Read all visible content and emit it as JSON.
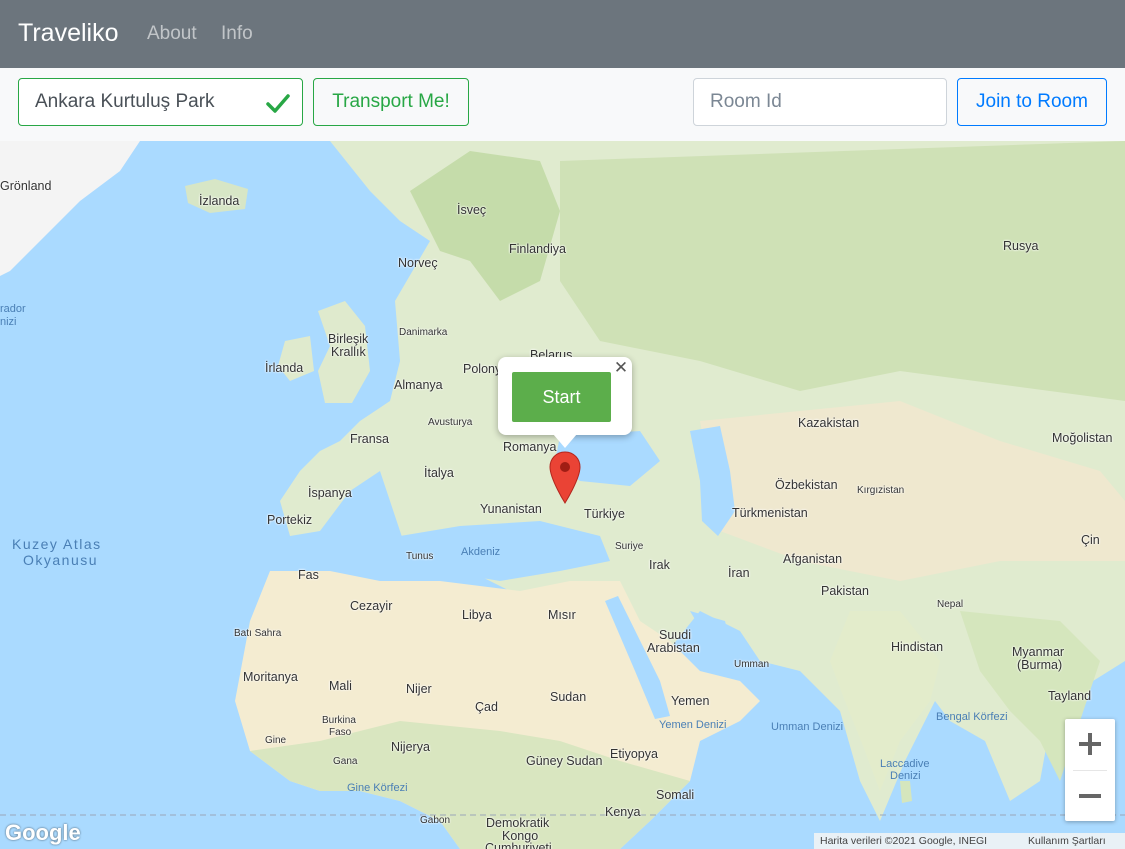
{
  "navbar": {
    "brand": "Traveliko",
    "links": [
      "About",
      "Info"
    ]
  },
  "toolbar": {
    "destination_value": "Ankara Kurtuluş Park",
    "transport_label": "Transport Me!",
    "room_placeholder": "Room Id",
    "join_label": "Join to Room"
  },
  "map": {
    "popup_button": "Start",
    "labels": {
      "gronland": "Grönland",
      "izlanda": "İzlanda",
      "isvec": "İsveç",
      "finlandiya": "Finlandiya",
      "norvec": "Norveç",
      "rusya": "Rusya",
      "birlesik": "Birleşik",
      "krallik": "Krallık",
      "danimarka": "Danimarka",
      "irlanda": "İrlanda",
      "polonya": "Polonya",
      "belarus": "Belarus",
      "almanya": "Almanya",
      "avusturya": "Avusturya",
      "fransa": "Fransa",
      "romanya": "Romanya",
      "kazakistan": "Kazakistan",
      "mogolistan": "Moğolistan",
      "italya": "İtalya",
      "ispanya": "İspanya",
      "portekiz": "Portekiz",
      "yunanistan": "Yunanistan",
      "turkiye": "Türkiye",
      "ozbekistan": "Özbekistan",
      "kirgizistan": "Kırgızistan",
      "turkmenistan": "Türkmenistan",
      "kuzey1": "Kuzey Atlas",
      "kuzey2": "Okyanusu",
      "tunus": "Tunus",
      "akdeniz": "Akdeniz",
      "suriye": "Suriye",
      "irak": "Irak",
      "iran": "İran",
      "afganistan": "Afganistan",
      "cin": "Çin",
      "fas": "Fas",
      "cezayir": "Cezayir",
      "libya": "Libya",
      "misir": "Mısır",
      "pakistan": "Pakistan",
      "nepal": "Nepal",
      "batisahra": "Batı Sahra",
      "suudi1": "Suudi",
      "suudi2": "Arabistan",
      "umman": "Umman",
      "hindistan": "Hindistan",
      "myanmar1": "Myanmar",
      "myanmar2": "(Burma)",
      "moritanya": "Moritanya",
      "mali": "Mali",
      "nijer": "Nijer",
      "cad": "Çad",
      "sudan": "Sudan",
      "yemen": "Yemen",
      "tayland": "Tayland",
      "yemendenizi": "Yemen Denizi",
      "ummandenizi": "Umman Denizi",
      "bengal": "Bengal Körfezi",
      "burkina1": "Burkina",
      "burkina2": "Faso",
      "gine": "Gine",
      "nijerya": "Nijerya",
      "etiyopya": "Etiyopya",
      "laccadive1": "Laccadive",
      "laccadive2": "Denizi",
      "gana": "Gana",
      "guneysudan": "Güney Sudan",
      "ginekorfezi": "Gine Körfezi",
      "somali": "Somali",
      "kenya": "Kenya",
      "gabon": "Gabon",
      "kongo1": "Demokratik",
      "kongo2": "Kongo",
      "kongo3": "Cumhuriyeti",
      "labrador1": "rador",
      "labrador2": "nizi"
    },
    "google_logo": "Google",
    "attribution": "Harita verileri ©2021 Google, INEGI",
    "terms": "Kullanım Şartları",
    "zoom_in": "+",
    "zoom_out": "−"
  },
  "icons": {
    "valid": "checkmark-icon",
    "close": "close-icon",
    "marker": "map-pin-icon"
  },
  "colors": {
    "navbar": "#6c757d",
    "success": "#28a745",
    "primary": "#007bff",
    "start_button": "#5cae4b",
    "marker": "#ea4335",
    "water": "#aadaff"
  }
}
